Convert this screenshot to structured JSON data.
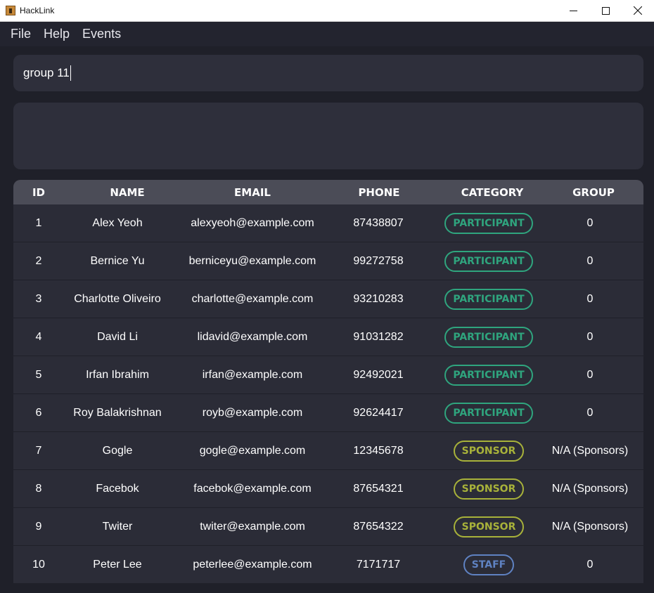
{
  "window": {
    "title": "HackLink"
  },
  "menu": {
    "items": [
      "File",
      "Help",
      "Events"
    ]
  },
  "command": {
    "value": "group 11"
  },
  "result": {
    "text": ""
  },
  "table": {
    "headers": {
      "id": "ID",
      "name": "NAME",
      "email": "EMAIL",
      "phone": "PHONE",
      "category": "CATEGORY",
      "group": "GROUP"
    },
    "rows": [
      {
        "id": "1",
        "name": "Alex Yeoh",
        "email": "alexyeoh@example.com",
        "phone": "87438807",
        "category": "PARTICIPANT",
        "group": "0"
      },
      {
        "id": "2",
        "name": "Bernice Yu",
        "email": "berniceyu@example.com",
        "phone": "99272758",
        "category": "PARTICIPANT",
        "group": "0"
      },
      {
        "id": "3",
        "name": "Charlotte Oliveiro",
        "email": "charlotte@example.com",
        "phone": "93210283",
        "category": "PARTICIPANT",
        "group": "0"
      },
      {
        "id": "4",
        "name": "David Li",
        "email": "lidavid@example.com",
        "phone": "91031282",
        "category": "PARTICIPANT",
        "group": "0"
      },
      {
        "id": "5",
        "name": "Irfan Ibrahim",
        "email": "irfan@example.com",
        "phone": "92492021",
        "category": "PARTICIPANT",
        "group": "0"
      },
      {
        "id": "6",
        "name": "Roy Balakrishnan",
        "email": "royb@example.com",
        "phone": "92624417",
        "category": "PARTICIPANT",
        "group": "0"
      },
      {
        "id": "7",
        "name": "Gogle",
        "email": "gogle@example.com",
        "phone": "12345678",
        "category": "SPONSOR",
        "group": "N/A (Sponsors)"
      },
      {
        "id": "8",
        "name": "Facebok",
        "email": "facebok@example.com",
        "phone": "87654321",
        "category": "SPONSOR",
        "group": "N/A (Sponsors)"
      },
      {
        "id": "9",
        "name": "Twiter",
        "email": "twiter@example.com",
        "phone": "87654322",
        "category": "SPONSOR",
        "group": "N/A (Sponsors)"
      },
      {
        "id": "10",
        "name": "Peter Lee",
        "email": "peterlee@example.com",
        "phone": "7171717",
        "category": "STAFF",
        "group": "0"
      }
    ]
  },
  "colors": {
    "participant": "#2fa57e",
    "sponsor": "#a8b23a",
    "staff": "#5f82c2",
    "background": "#1f2029",
    "panel": "#2e2f3b",
    "header": "#4b4c57"
  },
  "icons": {
    "app": "hacklink-app-icon",
    "minimize": "minimize-icon",
    "maximize": "maximize-icon",
    "close": "close-icon"
  }
}
